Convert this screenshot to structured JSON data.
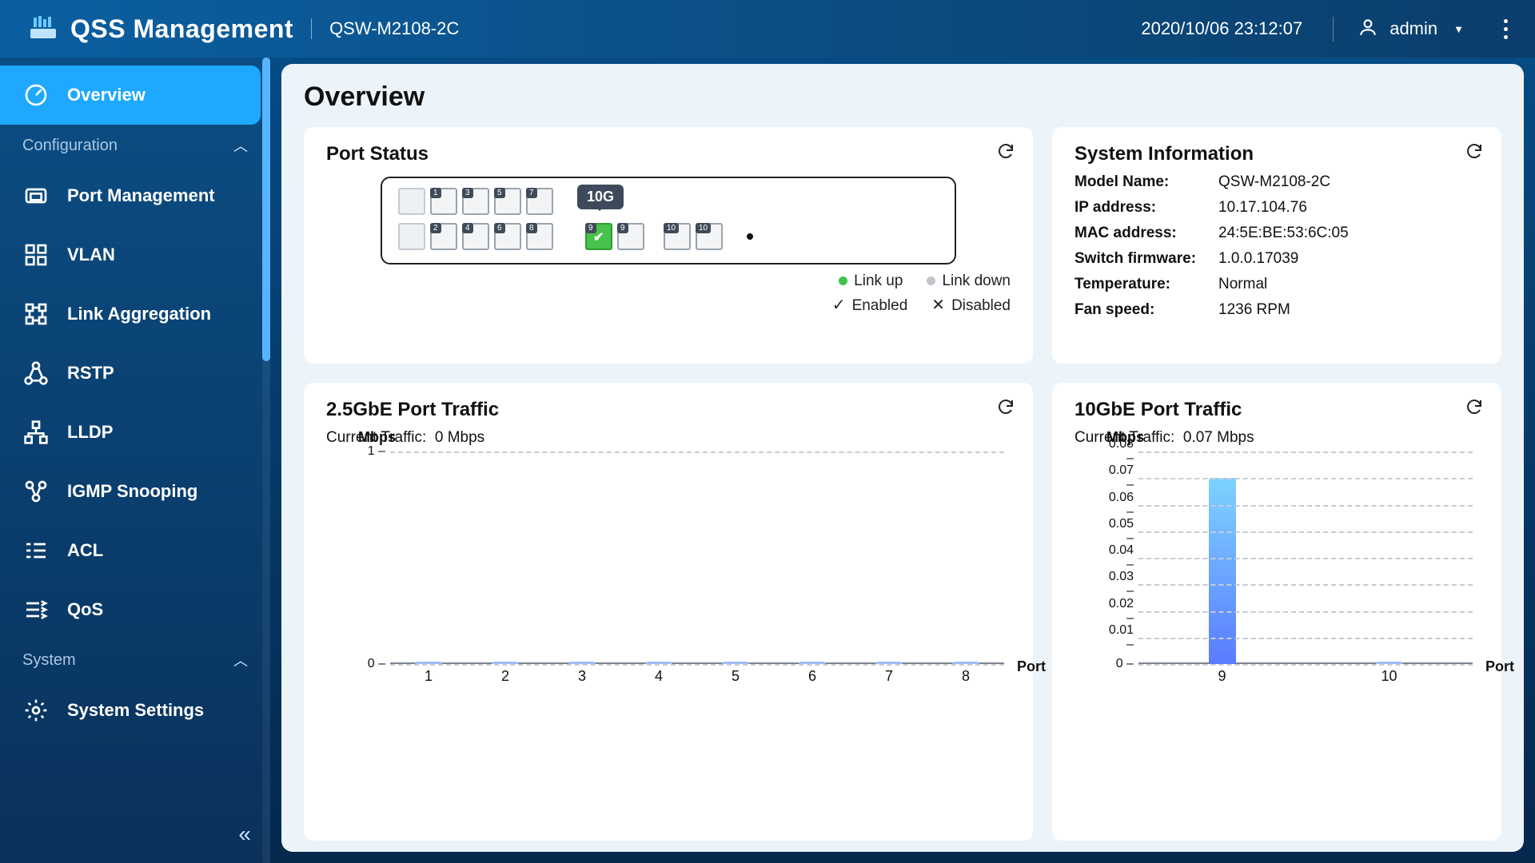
{
  "header": {
    "app_title": "QSS  Management",
    "model": "QSW-M2108-2C",
    "clock": "2020/10/06  23:12:07",
    "user": "admin"
  },
  "sidebar": {
    "active": "Overview",
    "section_config": "Configuration",
    "section_system": "System",
    "items": [
      {
        "label": "Overview"
      },
      {
        "label": "Port  Management"
      },
      {
        "label": "VLAN"
      },
      {
        "label": "Link  Aggregation"
      },
      {
        "label": "RSTP"
      },
      {
        "label": "LLDP"
      },
      {
        "label": "IGMP Snooping"
      },
      {
        "label": "ACL"
      },
      {
        "label": "QoS"
      },
      {
        "label": "System  Settings"
      }
    ]
  },
  "page": {
    "title": "Overview"
  },
  "port_status": {
    "title": "Port  Status",
    "speed_badge": "10G",
    "legend": {
      "link_up": "Link  up",
      "link_down": "Link  down",
      "enabled": "Enabled",
      "disabled": "Disabled"
    },
    "active_ports": [
      9
    ]
  },
  "sysinfo": {
    "title": "System  Information",
    "rows": [
      {
        "k": "Model Name:",
        "v": "QSW-M2108-2C"
      },
      {
        "k": "IP address:",
        "v": "10.17.104.76"
      },
      {
        "k": "MAC address:",
        "v": "24:5E:BE:53:6C:05"
      },
      {
        "k": "Switch firmware:",
        "v": "1.0.0.17039"
      },
      {
        "k": "Temperature:",
        "v": "Normal"
      },
      {
        "k": "Fan speed:",
        "v": "1236 RPM"
      }
    ]
  },
  "chart_left": {
    "title": "2.5GbE  Port  Traffic",
    "current_label": "Current  Traffic:",
    "current_value": "0  Mbps"
  },
  "chart_right": {
    "title": "10GbE  Port  Traffic",
    "current_label": "Current  Traffic:",
    "current_value": "0.07  Mbps"
  },
  "chart_labels": {
    "ylabel": "Mbps",
    "xlabel": "Port"
  },
  "chart_data": [
    {
      "type": "bar",
      "title": "2.5GbE Port Traffic",
      "xlabel": "Port",
      "ylabel": "Mbps",
      "categories": [
        "1",
        "2",
        "3",
        "4",
        "5",
        "6",
        "7",
        "8"
      ],
      "values": [
        0,
        0,
        0,
        0,
        0,
        0,
        0,
        0
      ],
      "ylim": [
        0,
        1
      ],
      "yticks": [
        0,
        1
      ]
    },
    {
      "type": "bar",
      "title": "10GbE Port Traffic",
      "xlabel": "Port",
      "ylabel": "Mbps",
      "categories": [
        "9",
        "10"
      ],
      "values": [
        0.07,
        0
      ],
      "ylim": [
        0,
        0.08
      ],
      "yticks": [
        0,
        0.01,
        0.02,
        0.03,
        0.04,
        0.05,
        0.06,
        0.07,
        0.08
      ]
    }
  ]
}
